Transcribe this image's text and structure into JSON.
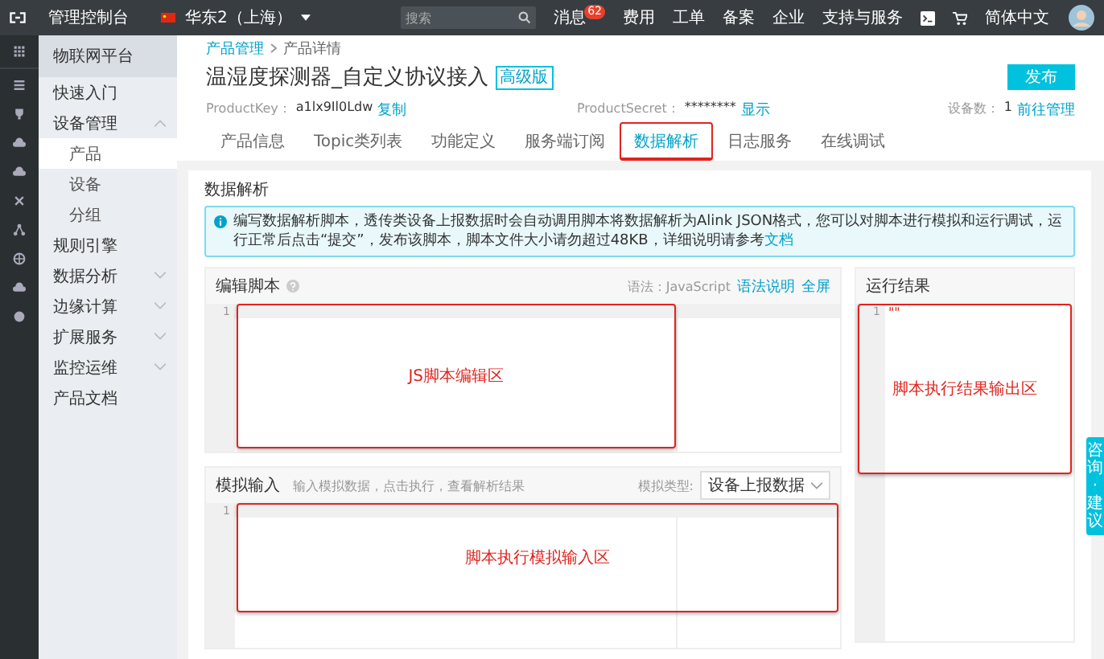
{
  "topbar": {
    "console": "管理控制台",
    "region": "华东2（上海）",
    "search": {
      "placeholder": "搜索"
    },
    "nav": [
      {
        "label": "消息",
        "badge": "62"
      },
      {
        "label": "费用"
      },
      {
        "label": "工单"
      },
      {
        "label": "备案"
      },
      {
        "label": "企业"
      },
      {
        "label": "支持与服务"
      }
    ],
    "language": "简体中文"
  },
  "sidebar": {
    "title": "物联网平台",
    "items": [
      {
        "label": "快速入门",
        "kind": "link",
        "selected": false
      },
      {
        "label": "设备管理",
        "kind": "group",
        "expanded": true,
        "selected": false,
        "children": [
          {
            "label": "产品",
            "selected": true
          },
          {
            "label": "设备",
            "selected": false
          },
          {
            "label": "分组",
            "selected": false
          }
        ]
      },
      {
        "label": "规则引擎",
        "kind": "link",
        "selected": false
      },
      {
        "label": "数据分析",
        "kind": "group",
        "expanded": false,
        "selected": false
      },
      {
        "label": "边缘计算",
        "kind": "group",
        "expanded": false,
        "selected": false
      },
      {
        "label": "扩展服务",
        "kind": "group",
        "expanded": false,
        "selected": false
      },
      {
        "label": "监控运维",
        "kind": "group",
        "expanded": false,
        "selected": false
      },
      {
        "label": "产品文档",
        "kind": "link",
        "selected": false
      }
    ]
  },
  "breadcrumb": [
    "产品管理",
    "产品详情"
  ],
  "header": {
    "title": "温湿度探测器_自定义协议接入",
    "badge": "高级版",
    "publish": "发布",
    "meta": [
      {
        "label": "ProductKey：",
        "value": "a1lx9Il0Ldw",
        "link": "复制"
      },
      {
        "label": "ProductSecret：",
        "value": "********",
        "link": "显示"
      },
      {
        "label": "设备数：",
        "value": "1",
        "link": "前往管理"
      }
    ]
  },
  "tabs": [
    {
      "label": "产品信息",
      "selected": false,
      "highlighted": false
    },
    {
      "label": "Topic类列表",
      "selected": false,
      "highlighted": false
    },
    {
      "label": "功能定义",
      "selected": false,
      "highlighted": false
    },
    {
      "label": "服务端订阅",
      "selected": false,
      "highlighted": false
    },
    {
      "label": "数据解析",
      "selected": true,
      "highlighted": true
    },
    {
      "label": "日志服务",
      "selected": false,
      "highlighted": false
    },
    {
      "label": "在线调试",
      "selected": false,
      "highlighted": false
    }
  ],
  "section_title": "数据解析",
  "notice": {
    "text": "编写数据解析脚本，透传类设备上报数据时会自动调用脚本将数据解析为Alink JSON格式，您可以对脚本进行模拟和运行调试，运行正常后点击“提交”，发布该脚本，脚本文件大小请勿超过48KB，详细说明请参考",
    "link": "文档"
  },
  "editor": {
    "title": "编辑脚本",
    "syntax": "语法：JavaScript",
    "links": [
      "语法说明",
      "全屏"
    ],
    "line_number": "1",
    "annotation": "JS脚本编辑区"
  },
  "simulation": {
    "title": "模拟输入",
    "hint": "输入模拟数据，点击执行，查看解析结果",
    "type_label": "模拟类型:",
    "type_value": "设备上报数据",
    "line_number": "1",
    "annotation": "脚本执行模拟输入区"
  },
  "result": {
    "title": "运行结果",
    "line_number": "1",
    "content": "\"\"",
    "annotation": "脚本执行结果输出区"
  },
  "feedback_tab": "咨询·建议"
}
